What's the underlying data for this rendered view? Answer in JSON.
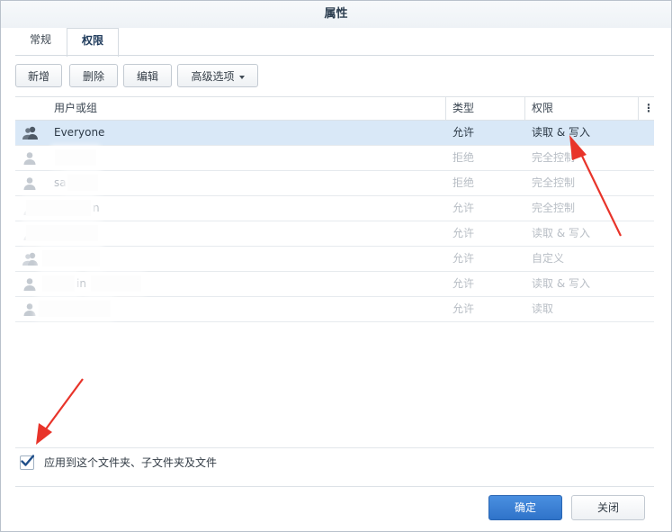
{
  "dialog": {
    "title": "属性"
  },
  "tabs": [
    {
      "label": "常规"
    },
    {
      "label": "权限"
    }
  ],
  "toolbar": {
    "add": "新增",
    "delete": "删除",
    "edit": "编辑",
    "advanced": "高级选项"
  },
  "columns": {
    "user": "用户或组",
    "type": "类型",
    "permission": "权限",
    "more": "⋮"
  },
  "rows": [
    {
      "name": "Everyone",
      "type": "允许",
      "permission": "读取 & 写入",
      "icon": "group-icon"
    },
    {
      "name": "",
      "type": "拒绝",
      "permission": "完全控制",
      "icon": "user-icon"
    },
    {
      "name": "sa",
      "type": "拒绝",
      "permission": "完全控制",
      "icon": "user-icon"
    },
    {
      "name": "n",
      "type": "允许",
      "permission": "完全控制",
      "icon": "user-icon"
    },
    {
      "name": "",
      "type": "允许",
      "permission": "读取 & 写入",
      "icon": "user-icon"
    },
    {
      "name": "",
      "type": "允许",
      "permission": "自定义",
      "icon": "group-icon"
    },
    {
      "name": "in",
      "type": "允许",
      "permission": "读取 & 写入",
      "icon": "user-icon"
    },
    {
      "name": "",
      "type": "允许",
      "permission": "读取",
      "icon": "user-icon"
    }
  ],
  "apply_checkbox": {
    "label": "应用到这个文件夹、子文件夹及文件",
    "checked": true
  },
  "footer": {
    "ok": "确定",
    "close": "关闭"
  },
  "colors": {
    "accent": "#2f73c9",
    "selected_row": "#d9e8f7",
    "annotation_arrow": "#e8342a"
  }
}
